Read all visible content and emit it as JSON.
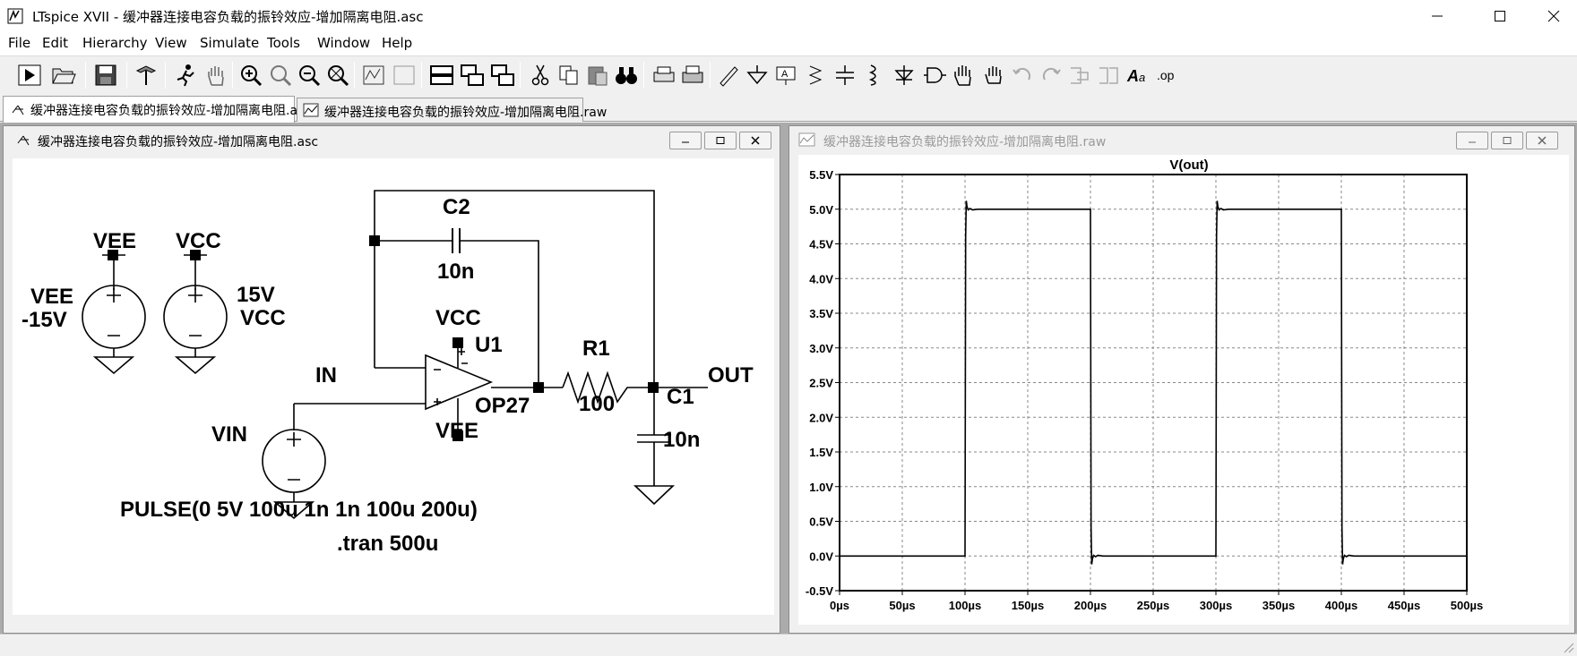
{
  "window": {
    "title": "LTspice XVII - 缓冲器连接电容负载的振铃效应-增加隔离电阻.asc"
  },
  "menu": [
    "File",
    "Edit",
    "Hierarchy",
    "View",
    "Simulate",
    "Tools",
    "Window",
    "Help"
  ],
  "tabs": [
    {
      "label": "缓冲器连接电容负载的振铃效应-增加隔离电阻.asc",
      "icon": "schematic-icon"
    },
    {
      "label": "缓冲器连接电容负载的振铃效应-增加隔离电阻.raw",
      "icon": "waveform-icon"
    }
  ],
  "schematic": {
    "title": "缓冲器连接电容负载的振铃效应-增加隔离电阻.asc",
    "labels": {
      "vee_flag": "VEE",
      "vcc_flag": "VCC",
      "vee_name": "VEE",
      "vee_value": "-15V",
      "vcc_value": "15V",
      "vcc_name": "VCC",
      "c2_name": "C2",
      "c2_value": "10n",
      "u1_vcc": "VCC",
      "u1_name": "U1",
      "u1_model": "OP27",
      "u1_vee": "VEE",
      "net_in": "IN",
      "net_out": "OUT",
      "r1_name": "R1",
      "r1_value": "100",
      "c1_name": "C1",
      "c1_value": "10n",
      "vin_name": "VIN",
      "pulse": "PULSE(0 5V 100u 1n 1n 100u 200u)",
      "tran": ".tran 500u"
    }
  },
  "waveform": {
    "title": "缓冲器连接电容负载的振铃效应-增加隔离电阻.raw"
  },
  "chart_data": {
    "type": "line",
    "title": "V(out)",
    "xlabel": "",
    "ylabel": "",
    "xlim": [
      0,
      500
    ],
    "ylim": [
      -0.5,
      5.5
    ],
    "x_ticks": [
      "0µs",
      "50µs",
      "100µs",
      "150µs",
      "200µs",
      "250µs",
      "300µs",
      "350µs",
      "400µs",
      "450µs",
      "500µs"
    ],
    "y_ticks": [
      "5.5V",
      "5.0V",
      "4.5V",
      "4.0V",
      "3.5V",
      "3.0V",
      "2.5V",
      "2.0V",
      "1.5V",
      "1.0V",
      "0.5V",
      "0.0V",
      "-0.5V"
    ],
    "grid": true,
    "series": [
      {
        "name": "V(out)",
        "color": "#000000",
        "x_unit": "µs",
        "points": [
          [
            0,
            0
          ],
          [
            100,
            0
          ],
          [
            100.5,
            4.6
          ],
          [
            101,
            5.12
          ],
          [
            101.6,
            5.04
          ],
          [
            102.5,
            4.99
          ],
          [
            104,
            5.01
          ],
          [
            106,
            4.99
          ],
          [
            110,
            5.0
          ],
          [
            200,
            5.0
          ],
          [
            200.5,
            0.4
          ],
          [
            201,
            -0.12
          ],
          [
            201.6,
            -0.04
          ],
          [
            202.5,
            0.01
          ],
          [
            204,
            -0.01
          ],
          [
            206,
            0.01
          ],
          [
            210,
            0.0
          ],
          [
            300,
            0.0
          ],
          [
            300.5,
            4.6
          ],
          [
            301,
            5.12
          ],
          [
            301.6,
            5.04
          ],
          [
            302.5,
            4.99
          ],
          [
            304,
            5.01
          ],
          [
            306,
            4.99
          ],
          [
            310,
            5.0
          ],
          [
            400,
            5.0
          ],
          [
            400.5,
            0.4
          ],
          [
            401,
            -0.12
          ],
          [
            401.6,
            -0.04
          ],
          [
            402.5,
            0.01
          ],
          [
            404,
            -0.01
          ],
          [
            406,
            0.01
          ],
          [
            410,
            0.0
          ],
          [
            500,
            0.0
          ]
        ]
      }
    ]
  }
}
